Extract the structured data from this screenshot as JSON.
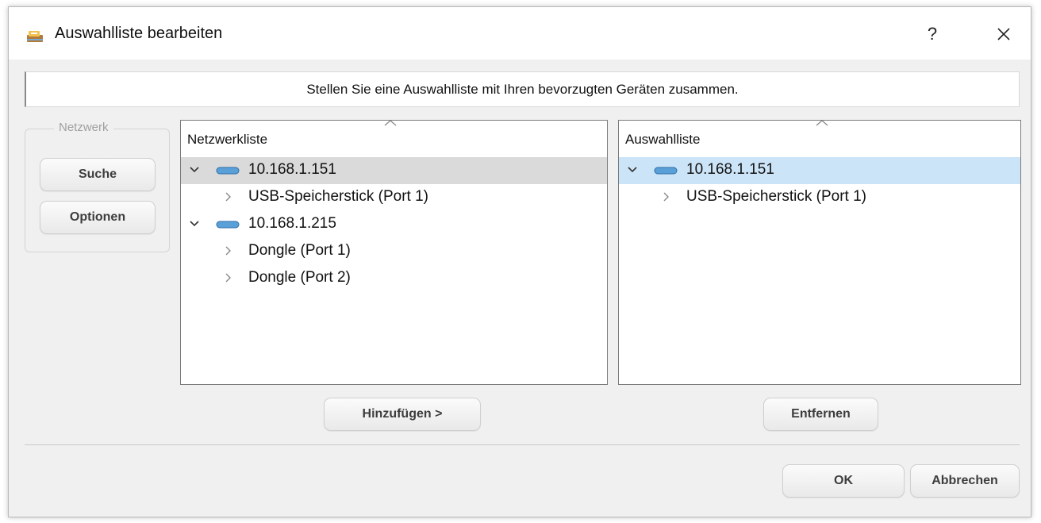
{
  "window": {
    "title": "Auswahlliste bearbeiten",
    "help_label": "?",
    "close_icon": "close-icon",
    "app_icon": "app-icon"
  },
  "banner": {
    "text": "Stellen Sie eine Auswahlliste mit Ihren bevorzugten Geräten zusammen."
  },
  "network_group": {
    "label": "Netzwerk",
    "search_label": "Suche",
    "options_label": "Optionen"
  },
  "network_list": {
    "header": "Netzwerkliste",
    "items": [
      {
        "label": "10.168.1.151",
        "kind": "host",
        "expanded": true,
        "selected": true
      },
      {
        "label": "USB-Speicherstick (Port 1)",
        "kind": "port"
      },
      {
        "label": "10.168.1.215",
        "kind": "host",
        "expanded": true
      },
      {
        "label": "Dongle (Port 1)",
        "kind": "port"
      },
      {
        "label": "Dongle (Port 2)",
        "kind": "port"
      }
    ],
    "add_label": "Hinzufügen >"
  },
  "selection_list": {
    "header": "Auswahlliste",
    "items": [
      {
        "label": "10.168.1.151",
        "kind": "host",
        "expanded": true,
        "selected": true
      },
      {
        "label": "USB-Speicherstick (Port 1)",
        "kind": "port"
      }
    ],
    "remove_label": "Entfernen"
  },
  "footer": {
    "ok_label": "OK",
    "cancel_label": "Abbrechen"
  },
  "colors": {
    "dialog_bg": "#f0f0f0",
    "selection_gray": "#dadada",
    "selection_blue": "#cce4f7",
    "device_icon": "#5aa0d8"
  }
}
